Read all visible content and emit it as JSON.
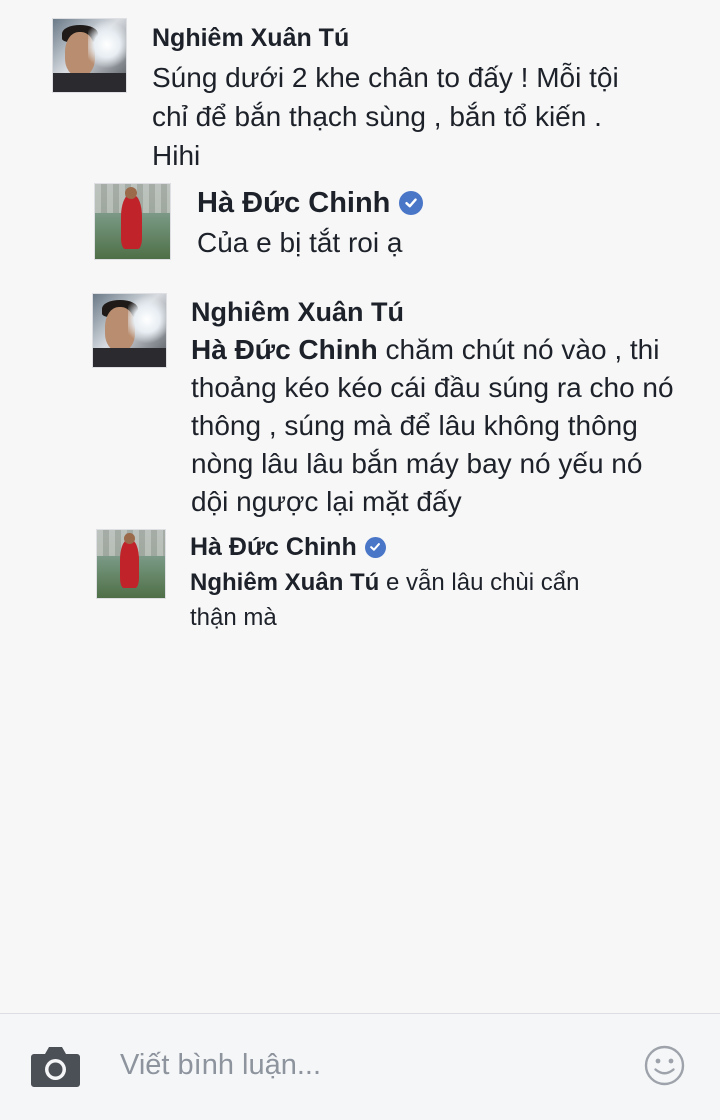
{
  "comments": [
    {
      "author": "Nghiêm Xuân Tú",
      "verified": false,
      "lines": [
        "Súng dưới 2 khe chân to đấy ! Mỗi tội",
        "chỉ để bắn thạch sùng , bắn tổ kiến .",
        "Hihi"
      ]
    },
    {
      "author": "Hà Đức Chinh",
      "verified": true,
      "lines": [
        "Của e bị tắt roi ạ"
      ]
    },
    {
      "author": "Nghiêm Xuân Tú",
      "verified": false,
      "mention": "Hà Đức Chinh",
      "first_line_rest": " chăm chút nó vào , thi",
      "lines": [
        "thoảng kéo kéo cái đầu súng ra cho nó",
        "thông , súng mà để lâu không thông",
        "nòng lâu lâu bắn máy bay nó yếu nó",
        "dội ngược lại mặt đấy"
      ]
    },
    {
      "author": "Hà Đức Chinh",
      "verified": true,
      "mention": "Nghiêm Xuân Tú",
      "first_line_rest": " e vẫn lâu chùi cẩn",
      "lines": [
        "thận mà"
      ]
    }
  ],
  "composer": {
    "placeholder": "Viết bình luận...",
    "camera_icon": "camera-icon",
    "emoji_icon": "smile-icon"
  },
  "colors": {
    "background": "#f7f7f7",
    "text": "#1d2129",
    "placeholder": "#8d949e",
    "verified_badge": "#4a76c8",
    "bar": "#f5f6f7"
  }
}
